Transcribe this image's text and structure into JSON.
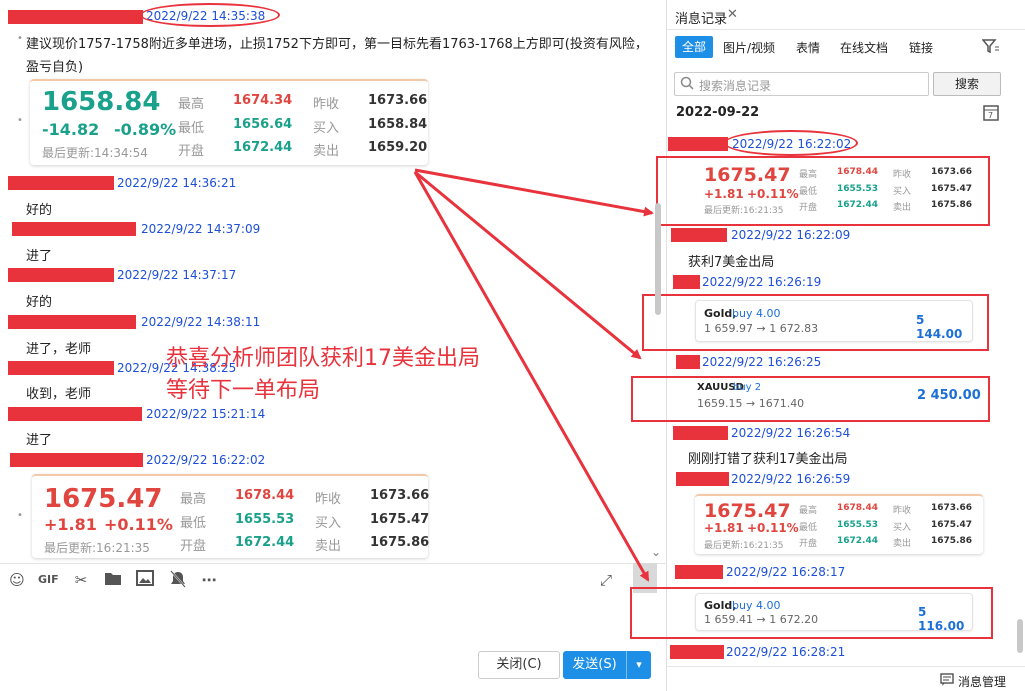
{
  "left": {
    "t1": "2022/9/22 14:35:38",
    "advice": "建议现价1757-1758附近多单进场，止损1752下方即可，第一目标先看1763-1768上方即可(投资有风险，",
    "advice2": "盈亏自负)",
    "quote1": {
      "price": "1658.84",
      "chg": "-14.82",
      "pct": "-0.89%",
      "updated": "最后更新:14:34:54",
      "l_high": "最高",
      "v_high": "1674.34",
      "l_low": "最低",
      "v_low": "1656.64",
      "l_open": "开盘",
      "v_open": "1672.44",
      "l_prev": "昨收",
      "v_prev": "1673.66",
      "l_bid": "买入",
      "v_bid": "1658.84",
      "l_ask": "卖出",
      "v_ask": "1659.20"
    },
    "t2": "2022/9/22 14:36:21",
    "m2": "好的",
    "t3": "2022/9/22 14:37:09",
    "m3": "进了",
    "t4": "2022/9/22 14:37:17",
    "m4": "好的",
    "t5": "2022/9/22 14:38:11",
    "m5": "进了，老师",
    "t6": "2022/9/22 14:38:25",
    "m6": "收到，老师",
    "t7": "2022/9/22 15:21:14",
    "m7": "进了",
    "t8": "2022/9/22 16:22:02",
    "quote2": {
      "price": "1675.47",
      "chg": "+1.81",
      "pct": "+0.11%",
      "updated": "最后更新:16:21:35",
      "l_high": "最高",
      "v_high": "1678.44",
      "l_low": "最低",
      "v_low": "1655.53",
      "l_open": "开盘",
      "v_open": "1672.44",
      "l_prev": "昨收",
      "v_prev": "1673.66",
      "l_bid": "买入",
      "v_bid": "1675.47",
      "l_ask": "卖出",
      "v_ask": "1675.86"
    },
    "annotation1": "恭喜分析师团队获利17美金出局",
    "annotation2": "等待下一单布局",
    "close_btn": "关闭(C)",
    "send_btn": "发送(S)"
  },
  "right": {
    "title": "消息记录",
    "tabs": [
      "全部",
      "图片/视频",
      "表情",
      "在线文档",
      "链接"
    ],
    "search_placeholder": "搜索消息记录",
    "search_btn": "搜索",
    "date": "2022-09-22",
    "r1": "2022/9/22 16:22:02",
    "quote": {
      "price": "1675.47",
      "chg": "+1.81",
      "pct": "+0.11%",
      "updated": "最后更新:16:21:35",
      "l_high": "最高",
      "v_high": "1678.44",
      "l_low": "最低",
      "v_low": "1655.53",
      "l_open": "开盘",
      "v_open": "1672.44",
      "l_prev": "昨收",
      "v_prev": "1673.66",
      "l_bid": "买入",
      "v_bid": "1675.47",
      "l_ask": "卖出",
      "v_ask": "1675.86"
    },
    "r2": "2022/9/22 16:22:09",
    "rm2": "获利7美金出局",
    "r3": "2022/9/22 16:26:19",
    "trade1": {
      "sym": "Gold,",
      "side": "buy 4.00",
      "range": "1 659.97 → 1 672.83",
      "profit": "5 144.00"
    },
    "r4": "2022/9/22 16:26:25",
    "trade2": {
      "sym": "XAUUSD",
      "side": "buy 2",
      "range": "1659.15 → 1671.40",
      "profit": "2 450.00"
    },
    "r5": "2022/9/22 16:26:54",
    "rm5": "刚刚打错了获利17美金出局",
    "r6": "2022/9/22 16:26:59",
    "quote3": {
      "price": "1675.47",
      "chg": "+1.81",
      "pct": "+0.11%",
      "updated": "最后更新:16:21:35",
      "l_high": "最高",
      "v_high": "1678.44",
      "l_low": "最低",
      "v_low": "1655.53",
      "l_open": "开盘",
      "v_open": "1672.44",
      "l_prev": "昨收",
      "v_prev": "1673.66",
      "l_bid": "买入",
      "v_bid": "1675.47",
      "l_ask": "卖出",
      "v_ask": "1675.86"
    },
    "r7": "2022/9/22 16:28:17",
    "trade3": {
      "sym": "Gold,",
      "side": "buy 4.00",
      "range": "1 659.41 → 1 672.20",
      "profit": "5 116.00"
    },
    "r8": "2022/9/22 16:28:21",
    "manage": "消息管理"
  },
  "colors": {
    "accent": "#1e8fe6",
    "red": "#e8323c",
    "up": "#e0463f",
    "down": "#1aa18b",
    "link": "#1d4fd8"
  }
}
